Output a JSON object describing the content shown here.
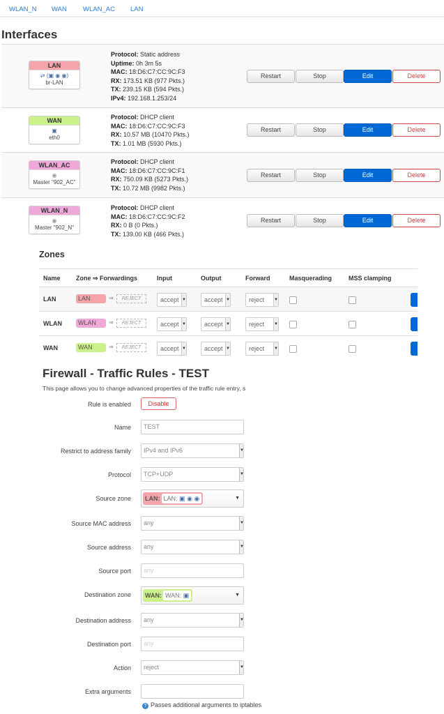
{
  "tabs": [
    "WLAN_N",
    "WAN",
    "WLAN_AC",
    "LAN"
  ],
  "interfaces_title": "Interfaces",
  "interfaces": [
    {
      "name": "LAN",
      "color": "#f4a4aa",
      "icons": "bridge, ethernet, wifi, wifi",
      "device": "br-LAN",
      "info": [
        {
          "k": "Protocol:",
          "v": " Static address"
        },
        {
          "k": "Uptime:",
          "v": " 0h 3m 5s"
        },
        {
          "k": "MAC:",
          "v": " 18:D6:C7:CC:9C:F3"
        },
        {
          "k": "RX:",
          "v": " 173.51 KB (977 Pkts.)"
        },
        {
          "k": "TX:",
          "v": " 239.15 KB (594 Pkts.)"
        },
        {
          "k": "IPv4:",
          "v": " 192.168.1.253/24"
        }
      ]
    },
    {
      "name": "WAN",
      "color": "#ccf08a",
      "icons": "ethernet",
      "device": "eth0",
      "info": [
        {
          "k": "Protocol:",
          "v": " DHCP client"
        },
        {
          "k": "MAC:",
          "v": " 18:D6:C7:CC:9C:F3"
        },
        {
          "k": "RX:",
          "v": " 10.57 MB (10470 Pkts.)"
        },
        {
          "k": "TX:",
          "v": " 1.01 MB (5930 Pkts.)"
        }
      ]
    },
    {
      "name": "WLAN_AC",
      "color": "#f0a8d8",
      "icons": "wifi",
      "device": "Master \"902_AC\"",
      "info": [
        {
          "k": "Protocol:",
          "v": " DHCP client"
        },
        {
          "k": "MAC:",
          "v": " 18:D6:C7:CC:9C:F1"
        },
        {
          "k": "RX:",
          "v": " 750.09 KB (5273 Pkts.)"
        },
        {
          "k": "TX:",
          "v": " 10.72 MB (9982 Pkts.)"
        }
      ]
    },
    {
      "name": "WLAN_N",
      "color": "#f0a8d8",
      "icons": "wifi",
      "device": "Master \"902_N\"",
      "info": [
        {
          "k": "Protocol:",
          "v": " DHCP client"
        },
        {
          "k": "MAC:",
          "v": " 18:D6:C7:CC:9C:F2"
        },
        {
          "k": "RX:",
          "v": " 0 B (0 Pkts.)"
        },
        {
          "k": "TX:",
          "v": " 139.00 KB (466 Pkts.)"
        }
      ]
    }
  ],
  "iface_buttons": {
    "restart": "Restart",
    "stop": "Stop",
    "edit": "Edit",
    "delete": "Delete"
  },
  "zones": {
    "title": "Zones",
    "headers": [
      "Name",
      "Zone ⇒ Forwardings",
      "Input",
      "Output",
      "Forward",
      "Masquerading",
      "MSS clamping"
    ],
    "rows": [
      {
        "name": "LAN",
        "zone": "LAN",
        "color": "#f4a4aa",
        "forward_to": "REJECT",
        "input": "accept",
        "output": "accept",
        "forward": "reject",
        "masq": false,
        "mss": false
      },
      {
        "name": "WLAN",
        "zone": "WLAN",
        "color": "#f0a8d8",
        "forward_to": "REJECT",
        "input": "accept",
        "output": "accept",
        "forward": "reject",
        "masq": false,
        "mss": false
      },
      {
        "name": "WAN",
        "zone": "WAN",
        "color": "#ccf08a",
        "forward_to": "REJECT",
        "input": "accept",
        "output": "accept",
        "forward": "reject",
        "masq": false,
        "mss": false
      }
    ],
    "arrow": "⇒"
  },
  "firewall": {
    "title": "Firewall - Traffic Rules - TEST",
    "description": "This page allows you to change advanced properties of the traffic rule entry, s",
    "rule_enabled_label": "Rule is enabled",
    "disable_label": "Disable",
    "fields": {
      "name": {
        "label": "Name",
        "value": "TEST"
      },
      "family": {
        "label": "Restrict to address family",
        "value": "IPv4 and IPv6"
      },
      "protocol": {
        "label": "Protocol",
        "value": "TCP+UDP"
      },
      "src_zone": {
        "label": "Source zone",
        "zone": "LAN:",
        "inner": "LAN:",
        "color": "#f4a4aa"
      },
      "src_mac": {
        "label": "Source MAC address",
        "value": "any"
      },
      "src_addr": {
        "label": "Source address",
        "value": "any"
      },
      "src_port": {
        "label": "Source port",
        "placeholder": "any"
      },
      "dest_zone": {
        "label": "Destination zone",
        "zone": "WAN:",
        "inner": "WAN:",
        "color": "#ccf08a"
      },
      "dest_addr": {
        "label": "Destination address",
        "value": "any"
      },
      "dest_port": {
        "label": "Destination port",
        "placeholder": "any"
      },
      "action": {
        "label": "Action",
        "value": "reject"
      },
      "extra": {
        "label": "Extra arguments",
        "value": "",
        "help": "Passes additional arguments to iptables"
      }
    }
  }
}
